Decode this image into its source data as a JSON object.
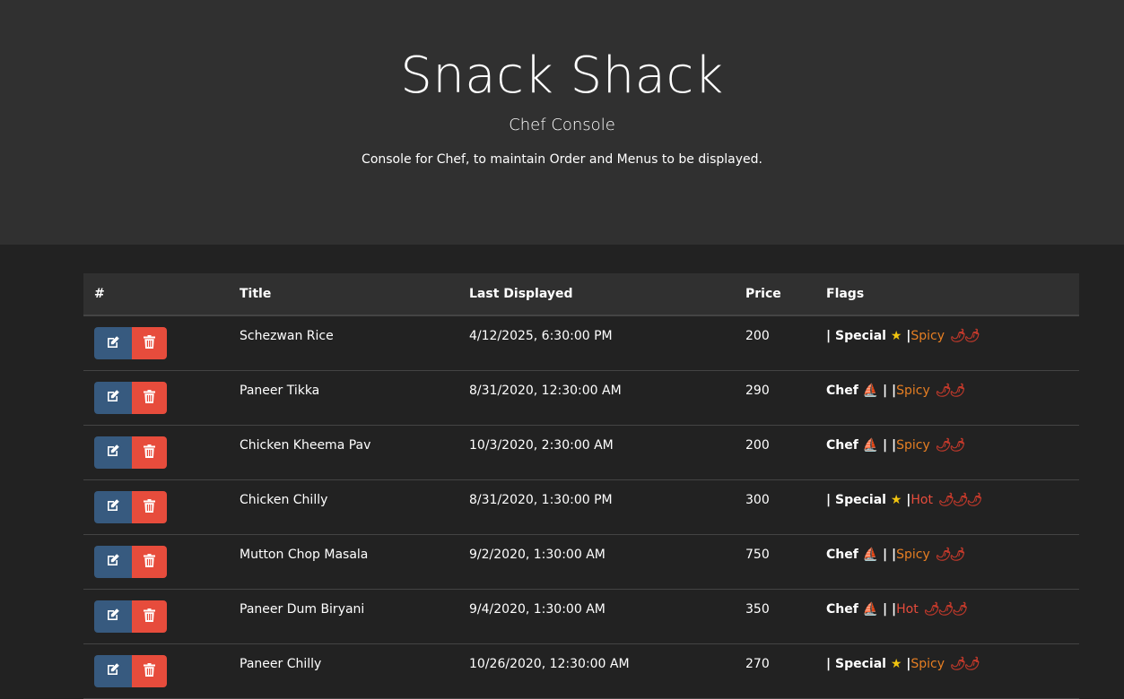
{
  "header": {
    "title": "Snack Shack",
    "subtitle": "Chef Console",
    "description": "Console for Chef, to maintain Order and Menus to be displayed."
  },
  "table": {
    "columns": [
      "#",
      "Title",
      "Last Displayed",
      "Price",
      "Flags"
    ],
    "rows": [
      {
        "title": "Schezwan Rice",
        "last_displayed": "4/12/2025, 6:30:00 PM",
        "price": "200",
        "chef": false,
        "special": true,
        "heat": "Spicy",
        "chillies": 2
      },
      {
        "title": "Paneer Tikka",
        "last_displayed": "8/31/2020, 12:30:00 AM",
        "price": "290",
        "chef": true,
        "special": false,
        "heat": "Spicy",
        "chillies": 2
      },
      {
        "title": "Chicken Kheema Pav",
        "last_displayed": "10/3/2020, 2:30:00 AM",
        "price": "200",
        "chef": true,
        "special": false,
        "heat": "Spicy",
        "chillies": 2
      },
      {
        "title": "Chicken Chilly",
        "last_displayed": "8/31/2020, 1:30:00 PM",
        "price": "300",
        "chef": false,
        "special": true,
        "heat": "Hot",
        "chillies": 3
      },
      {
        "title": "Mutton Chop Masala",
        "last_displayed": "9/2/2020, 1:30:00 AM",
        "price": "750",
        "chef": true,
        "special": false,
        "heat": "Spicy",
        "chillies": 2
      },
      {
        "title": "Paneer Dum Biryani",
        "last_displayed": "9/4/2020, 1:30:00 AM",
        "price": "350",
        "chef": true,
        "special": false,
        "heat": "Hot",
        "chillies": 3
      },
      {
        "title": "Paneer Chilly",
        "last_displayed": "10/26/2020, 12:30:00 AM",
        "price": "270",
        "chef": false,
        "special": true,
        "heat": "Spicy",
        "chillies": 2
      }
    ]
  },
  "flag_labels": {
    "chef": "Chef",
    "special": "Special"
  },
  "icons": {
    "edit": "edit-icon",
    "delete": "trash-icon",
    "chef": "chef-hat-icon",
    "special": "star-icon",
    "chilli": "chilli-icon"
  },
  "colors": {
    "edit": "#375a7f",
    "delete": "#e74c3c",
    "spicy": "#e67e22",
    "hot": "#e74c3c",
    "chef": "#3498db",
    "star": "#f1c40f"
  }
}
